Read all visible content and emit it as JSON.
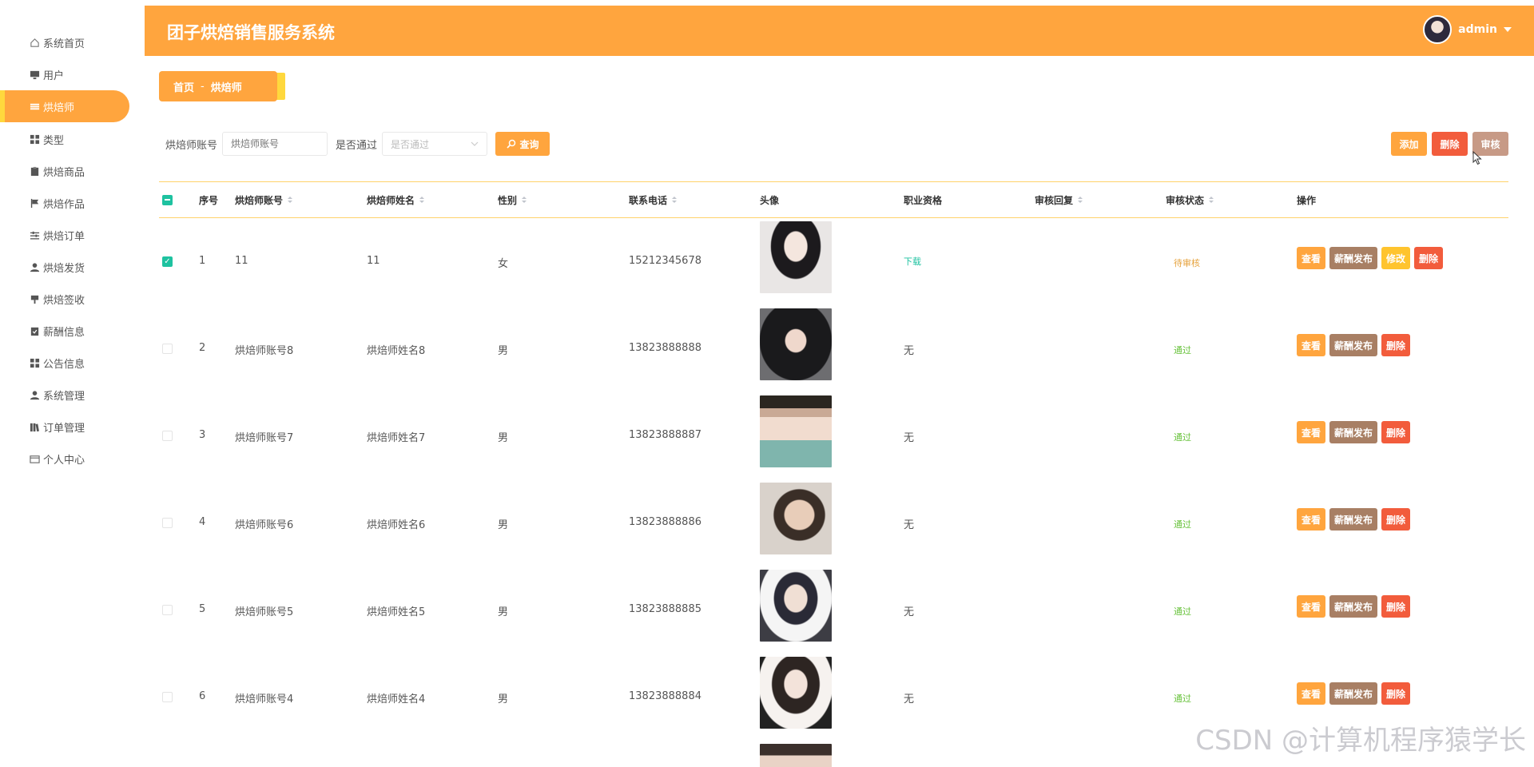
{
  "header": {
    "title": "团子烘焙销售服务系统",
    "user": "admin"
  },
  "sidebar": {
    "items": [
      {
        "label": "系统首页",
        "icon": "home-icon"
      },
      {
        "label": "用户",
        "icon": "monitor-icon"
      },
      {
        "label": "烘焙师",
        "icon": "list-icon",
        "active": true
      },
      {
        "label": "类型",
        "icon": "grid-icon"
      },
      {
        "label": "烘焙商品",
        "icon": "clipboard-icon"
      },
      {
        "label": "烘焙作品",
        "icon": "flag-icon"
      },
      {
        "label": "烘焙订单",
        "icon": "sliders-icon"
      },
      {
        "label": "烘焙发货",
        "icon": "user-icon"
      },
      {
        "label": "烘焙签收",
        "icon": "pin-icon"
      },
      {
        "label": "薪酬信息",
        "icon": "check-clipboard-icon"
      },
      {
        "label": "公告信息",
        "icon": "grid-icon"
      },
      {
        "label": "系统管理",
        "icon": "user-icon"
      },
      {
        "label": "订单管理",
        "icon": "books-icon"
      },
      {
        "label": "个人中心",
        "icon": "card-icon"
      }
    ]
  },
  "breadcrumb": {
    "home": "首页",
    "sep": "-",
    "current": "烘焙师"
  },
  "search": {
    "account_label": "烘焙师账号",
    "account_placeholder": "烘焙师账号",
    "passed_label": "是否通过",
    "passed_placeholder": "是否通过",
    "query_button": "查询"
  },
  "actions": {
    "add": "添加",
    "delete": "删除",
    "review": "审核"
  },
  "table": {
    "columns": [
      "序号",
      "烘焙师账号",
      "烘焙师姓名",
      "性别",
      "联系电话",
      "头像",
      "职业资格",
      "审核回复",
      "审核状态",
      "操作"
    ],
    "op_labels": {
      "view": "查看",
      "salary": "薪酬发布",
      "edit": "修改",
      "delete": "删除"
    },
    "rows": [
      {
        "no": "1",
        "account": "11",
        "name": "11",
        "gender": "女",
        "phone": "15212345678",
        "qualification": "下载",
        "reply": "",
        "status": "待审核",
        "checked": true,
        "editable": true
      },
      {
        "no": "2",
        "account": "烘焙师账号8",
        "name": "烘焙师姓名8",
        "gender": "男",
        "phone": "13823888888",
        "qualification": "无",
        "reply": "",
        "status": "通过",
        "checked": false,
        "editable": false
      },
      {
        "no": "3",
        "account": "烘焙师账号7",
        "name": "烘焙师姓名7",
        "gender": "男",
        "phone": "13823888887",
        "qualification": "无",
        "reply": "",
        "status": "通过",
        "checked": false,
        "editable": false
      },
      {
        "no": "4",
        "account": "烘焙师账号6",
        "name": "烘焙师姓名6",
        "gender": "男",
        "phone": "13823888886",
        "qualification": "无",
        "reply": "",
        "status": "通过",
        "checked": false,
        "editable": false
      },
      {
        "no": "5",
        "account": "烘焙师账号5",
        "name": "烘焙师姓名5",
        "gender": "男",
        "phone": "13823888885",
        "qualification": "无",
        "reply": "",
        "status": "通过",
        "checked": false,
        "editable": false
      },
      {
        "no": "6",
        "account": "烘焙师账号4",
        "name": "烘焙师姓名4",
        "gender": "男",
        "phone": "13823888884",
        "qualification": "无",
        "reply": "",
        "status": "通过",
        "checked": false,
        "editable": false
      }
    ]
  },
  "watermark": "CSDN @计算机程序猿学长",
  "colors": {
    "accent": "#ffa53e",
    "highlight": "#ffd83d",
    "danger": "#f25c3c",
    "salary": "#a87f64",
    "edit": "#ffc42e",
    "pass": "#67c23a",
    "pending": "#e6a23c",
    "check": "#1ec2a0"
  }
}
